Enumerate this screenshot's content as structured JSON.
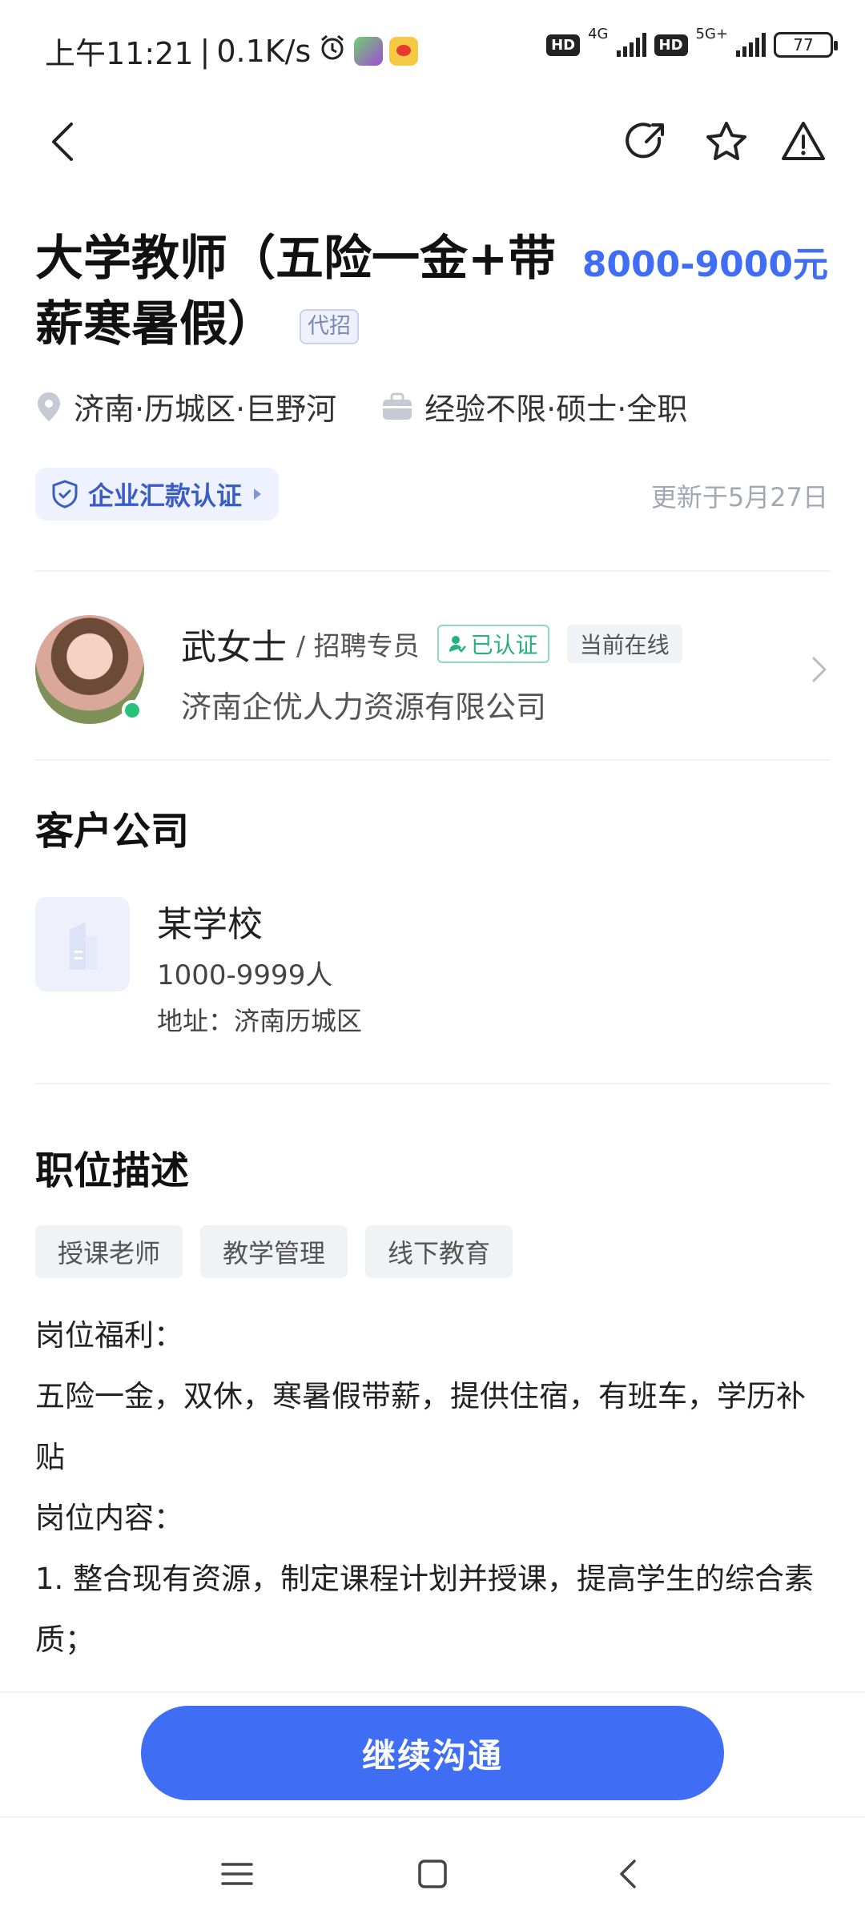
{
  "status_bar": {
    "time": "上午11:21",
    "net_speed": "0.1K/s",
    "sim1_net": "4G",
    "sim2_net": "5G+",
    "hd": "HD",
    "battery": "77"
  },
  "job": {
    "title": "大学教师（五险一金+带薪寒暑假）",
    "tag": "代招",
    "salary": "8000-9000元",
    "location": "济南·历城区·巨野河",
    "requirements": "经验不限·硕士·全职",
    "verify_label": "企业汇款认证",
    "updated": "更新于5月27日"
  },
  "recruiter": {
    "name": "武女士",
    "role": "/ 招聘专员",
    "verified": "已认证",
    "online": "当前在线",
    "company": "济南企优人力资源有限公司"
  },
  "client": {
    "heading": "客户公司",
    "name": "某学校",
    "size": "1000-9999人",
    "address": "地址：济南历城区"
  },
  "description": {
    "heading": "职位描述",
    "chips": [
      "授课老师",
      "教学管理",
      "线下教育"
    ],
    "lines": [
      "岗位福利：",
      "五险一金，双休，寒暑假带薪，提供住宿，有班车，学历补贴",
      "岗位内容：",
      "1. 整合现有资源，制定课程计划并授课，提高学生的综合素质；"
    ]
  },
  "actions": {
    "continue_chat": "继续沟通"
  },
  "colors": {
    "accent": "#3f6ef5",
    "verified_green": "#23b27a",
    "online_green": "#27c27a"
  }
}
